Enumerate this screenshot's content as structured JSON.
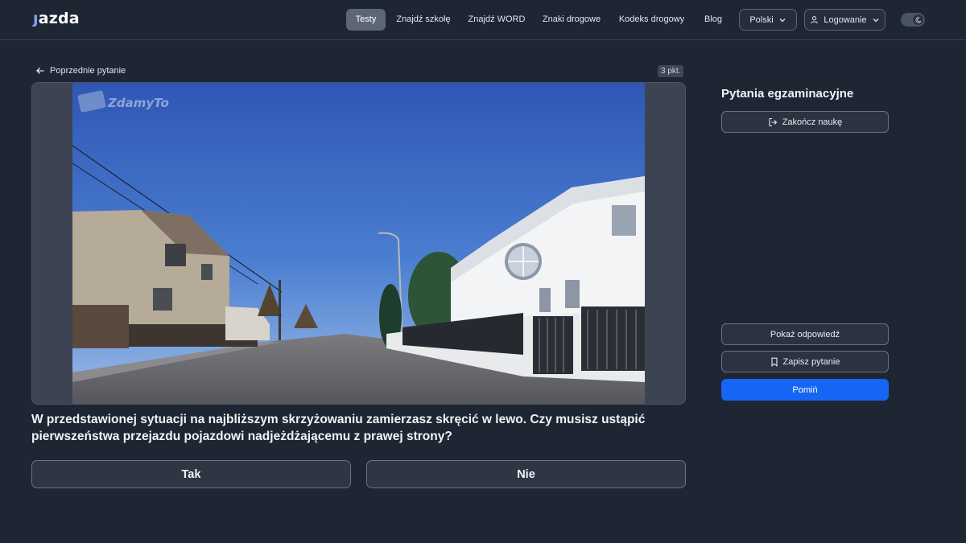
{
  "header": {
    "logo_text": "azda",
    "nav": [
      {
        "label": "Testy",
        "active": true
      },
      {
        "label": "Znajdź szkołę"
      },
      {
        "label": "Znajdź WORD"
      },
      {
        "label": "Znaki drogowe"
      },
      {
        "label": "Kodeks drogowy"
      },
      {
        "label": "Blog"
      }
    ],
    "language": "Polski",
    "login": "Logowanie",
    "theme_toggle_icon": "moon-icon"
  },
  "main": {
    "back_label": "Poprzednie pytanie",
    "points": "3 pkt.",
    "watermark": "ZdamyTo",
    "question": "W przedstawionej sytuacji na najbliższym skrzyżowaniu zamierzasz skręcić w lewo. Czy musisz ustąpić pierwszeństwa przejazdu pojazdowi nadjeżdżającemu z prawej strony?",
    "answers": [
      "Tak",
      "Nie"
    ]
  },
  "sidebar": {
    "title": "Pytania egzaminacyjne",
    "end_learning": "Zakończ naukę",
    "show_answer": "Pokaż odpowiedź",
    "save_question": "Zapisz pytanie",
    "skip": "Pomiń"
  },
  "colors": {
    "background": "#1e2533",
    "primary": "#1665f4",
    "nav_active": "#5d6674"
  }
}
